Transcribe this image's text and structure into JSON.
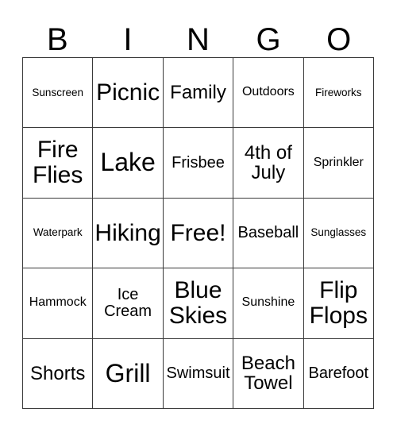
{
  "card": {
    "header_letters": [
      "B",
      "I",
      "N",
      "G",
      "O"
    ],
    "border_color": "#3a3a3a",
    "background_color": "#ffffff",
    "text_color": "#000000",
    "rows": 5,
    "columns": 5,
    "free_space_label": "Free!",
    "cells": [
      [
        {
          "label": "Sunscreen",
          "size": "s-xs",
          "lines": 1
        },
        {
          "label": "Picnic",
          "size": "s-xl",
          "lines": 1
        },
        {
          "label": "Family",
          "size": "s-lg",
          "lines": 1
        },
        {
          "label": "Outdoors",
          "size": "s-sm",
          "lines": 1
        },
        {
          "label": "Fireworks",
          "size": "s-xs",
          "lines": 1
        }
      ],
      [
        {
          "label": "Fire Flies",
          "size": "s-xl",
          "lines": 2
        },
        {
          "label": "Lake",
          "size": "s-xxl",
          "lines": 1
        },
        {
          "label": "Frisbee",
          "size": "s-md",
          "lines": 1
        },
        {
          "label": "4th of July",
          "size": "s-lg",
          "lines": 2
        },
        {
          "label": "Sprinkler",
          "size": "s-sm",
          "lines": 1
        }
      ],
      [
        {
          "label": "Waterpark",
          "size": "s-xs",
          "lines": 1
        },
        {
          "label": "Hiking",
          "size": "s-xl",
          "lines": 1
        },
        {
          "label": "Free!",
          "size": "s-xl",
          "lines": 1
        },
        {
          "label": "Baseball",
          "size": "s-md",
          "lines": 1
        },
        {
          "label": "Sunglasses",
          "size": "s-xs",
          "lines": 1
        }
      ],
      [
        {
          "label": "Hammock",
          "size": "s-sm",
          "lines": 1
        },
        {
          "label": "Ice Cream",
          "size": "s-md",
          "lines": 2
        },
        {
          "label": "Blue Skies",
          "size": "s-xl",
          "lines": 2
        },
        {
          "label": "Sunshine",
          "size": "s-sm",
          "lines": 1
        },
        {
          "label": "Flip Flops",
          "size": "s-xl",
          "lines": 2
        }
      ],
      [
        {
          "label": "Shorts",
          "size": "s-lg",
          "lines": 1
        },
        {
          "label": "Grill",
          "size": "s-xxl",
          "lines": 1
        },
        {
          "label": "Swimsuit",
          "size": "s-md",
          "lines": 1
        },
        {
          "label": "Beach Towel",
          "size": "s-lg",
          "lines": 2
        },
        {
          "label": "Barefoot",
          "size": "s-md",
          "lines": 1
        }
      ]
    ]
  }
}
